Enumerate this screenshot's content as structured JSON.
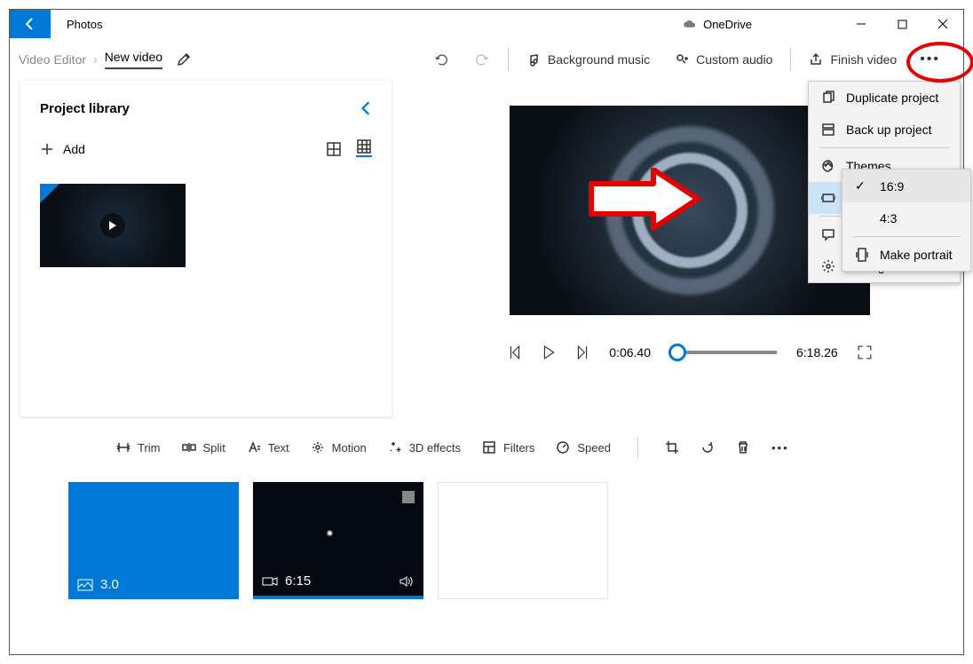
{
  "titlebar": {
    "app": "Photos",
    "cloud": "OneDrive"
  },
  "toolbar": {
    "crumb_root": "Video Editor",
    "crumb_current": "New video",
    "bg_music": "Background music",
    "custom_audio": "Custom audio",
    "finish": "Finish video"
  },
  "library": {
    "title": "Project library",
    "add": "Add"
  },
  "transport": {
    "current": "0:06.40",
    "total": "6:18.26"
  },
  "editbar": {
    "trim": "Trim",
    "split": "Split",
    "text": "Text",
    "motion": "Motion",
    "fx": "3D effects",
    "filters": "Filters",
    "speed": "Speed"
  },
  "clips": {
    "c1": "3.0",
    "c2": "6:15"
  },
  "menu": {
    "duplicate": "Duplicate project",
    "backup": "Back up project",
    "themes": "Themes",
    "aspect": "16:9 Landscape",
    "feedback": "Send feedback",
    "settings": "Settings"
  },
  "submenu": {
    "r169": "16:9",
    "r43": "4:3",
    "portrait": "Make portrait"
  }
}
